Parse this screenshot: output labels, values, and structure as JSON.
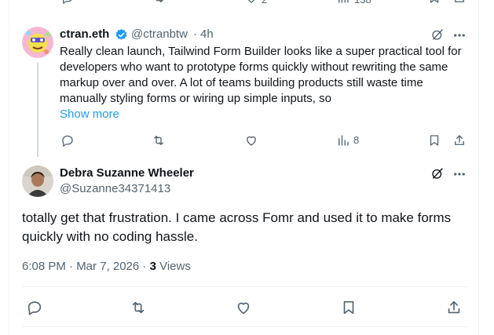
{
  "top_bar": {
    "like_count": "2",
    "view_count": "138"
  },
  "reply": {
    "author_name": "ctran.eth",
    "handle": "@ctranbtw",
    "separator": "·",
    "time": "4h",
    "text": "Really clean launch, Tailwind Form Builder looks like a super practical tool for developers who want to prototype forms quickly without rewriting the same markup over and over. A lot of teams building products still waste time manually styling forms or wiring up simple inputs, so",
    "show_more": "Show more",
    "view_count": "8"
  },
  "main_tweet": {
    "author_name": "Debra Suzanne Wheeler",
    "handle": "@Suzanne34371413",
    "text": "totally get that frustration. I came across Fomr and used it to make forms quickly with no coding hassle.",
    "timestamp": "6:08 PM · Mar 7, 2026 · ",
    "views_count": "3",
    "views_label": " Views"
  },
  "colors": {
    "accent": "#1d9bf0",
    "icon_gray": "#536471",
    "text": "#0f1419",
    "verified": "#1d9bf0"
  },
  "icons": [
    "reply-icon",
    "retweet-icon",
    "like-icon",
    "views-icon",
    "bookmark-icon",
    "share-icon",
    "grok-icon",
    "more-icon",
    "verified-icon"
  ]
}
